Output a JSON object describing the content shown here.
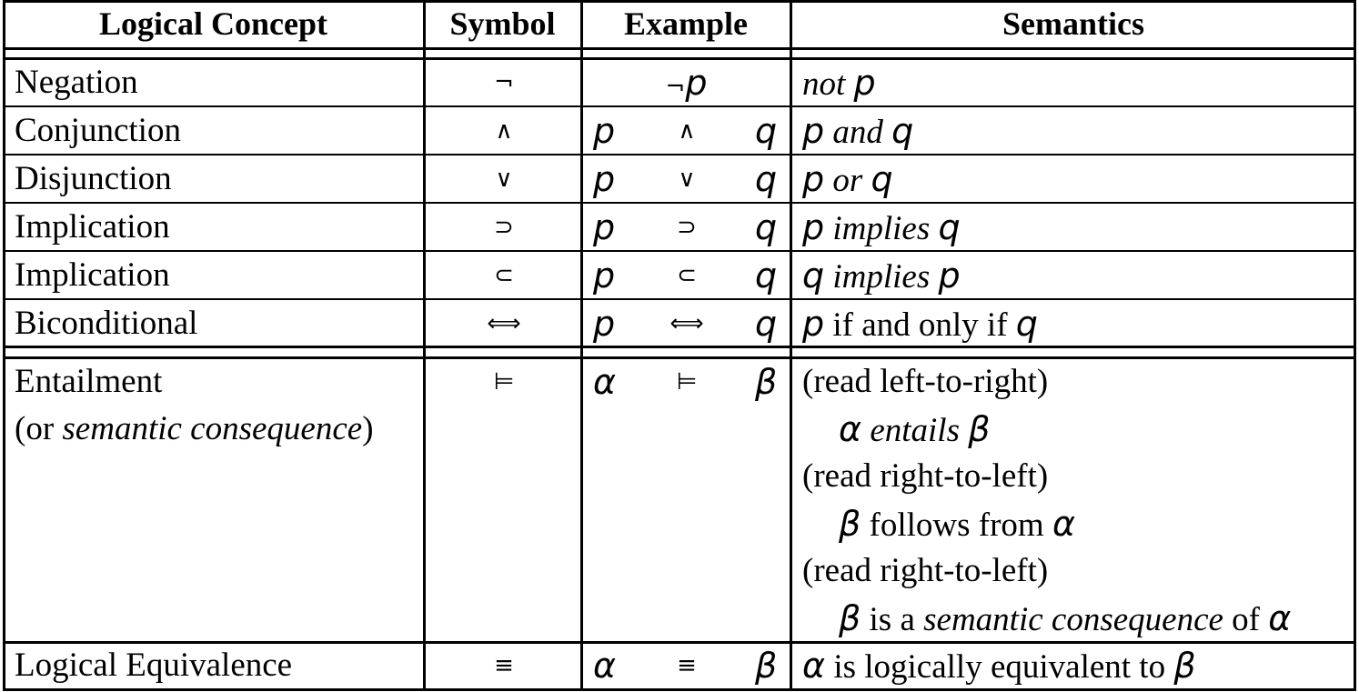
{
  "headers": [
    "Logical Concept",
    "Symbol",
    "Example",
    "Semantics"
  ],
  "rows": [
    {
      "concept": "Negation",
      "symbol": "¬",
      "example": {
        "left": "",
        "op": "¬",
        "right": "p",
        "centered": true
      },
      "semantics": [
        {
          "t": "not ",
          "style": "it"
        },
        {
          "t": "p",
          "style": "var"
        }
      ]
    },
    {
      "concept": "Conjunction",
      "symbol": "∧",
      "example": {
        "left": "p",
        "op": "∧",
        "right": "q"
      },
      "semantics": [
        {
          "t": "p",
          "style": "var"
        },
        {
          "t": " and ",
          "style": "it"
        },
        {
          "t": "q",
          "style": "var"
        }
      ]
    },
    {
      "concept": "Disjunction",
      "symbol": "∨",
      "example": {
        "left": "p",
        "op": "∨",
        "right": "q"
      },
      "semantics": [
        {
          "t": "p",
          "style": "var"
        },
        {
          "t": " or ",
          "style": "it"
        },
        {
          "t": "q",
          "style": "var"
        }
      ]
    },
    {
      "concept": "Implication",
      "symbol": "⊃",
      "example": {
        "left": "p",
        "op": "⊃",
        "right": "q"
      },
      "semantics": [
        {
          "t": "p",
          "style": "var"
        },
        {
          "t": " implies ",
          "style": "it"
        },
        {
          "t": "q",
          "style": "var"
        }
      ]
    },
    {
      "concept": "Implication",
      "symbol": "⊂",
      "example": {
        "left": "p",
        "op": "⊂",
        "right": "q"
      },
      "semantics": [
        {
          "t": "q",
          "style": "var"
        },
        {
          "t": " implies ",
          "style": "it"
        },
        {
          "t": "p",
          "style": "var"
        }
      ]
    },
    {
      "concept": "Biconditional",
      "symbol": "⟺",
      "example": {
        "left": "p",
        "op": "⟺",
        "right": "q"
      },
      "semantics": [
        {
          "t": "p",
          "style": "var"
        },
        {
          "t": " if and only if ",
          "style": "rm"
        },
        {
          "t": "q",
          "style": "var"
        }
      ]
    }
  ],
  "entailment": {
    "concept_line1": "Entailment",
    "concept_line2_prefix": "(or ",
    "concept_line2_italic": "semantic consequence",
    "concept_line2_suffix": ")",
    "symbol": "⊨",
    "example": {
      "left": "α",
      "op": "⊨",
      "right": "β"
    },
    "semantics_lines": [
      [
        {
          "t": "(read left-to-right)",
          "style": "rm"
        }
      ],
      [
        {
          "t": "α",
          "style": "var"
        },
        {
          "t": " entails ",
          "style": "it"
        },
        {
          "t": "β",
          "style": "var"
        }
      ],
      [
        {
          "t": "(read right-to-left)",
          "style": "rm"
        }
      ],
      [
        {
          "t": "β",
          "style": "var"
        },
        {
          "t": " follows from ",
          "style": "rm"
        },
        {
          "t": "α",
          "style": "var"
        }
      ],
      [
        {
          "t": "(read right-to-left)",
          "style": "rm"
        }
      ],
      [
        {
          "t": "β",
          "style": "var"
        },
        {
          "t": " is a ",
          "style": "rm"
        },
        {
          "t": "semantic consequence",
          "style": "it"
        },
        {
          "t": " of ",
          "style": "rm"
        },
        {
          "t": "α",
          "style": "var"
        }
      ]
    ]
  },
  "equivalence": {
    "concept": "Logical Equivalence",
    "symbol": "≡",
    "example": {
      "left": "α",
      "op": "≡",
      "right": "β"
    },
    "semantics": [
      {
        "t": "α",
        "style": "var"
      },
      {
        "t": " is logically equivalent to ",
        "style": "rm"
      },
      {
        "t": "β",
        "style": "var"
      }
    ]
  }
}
